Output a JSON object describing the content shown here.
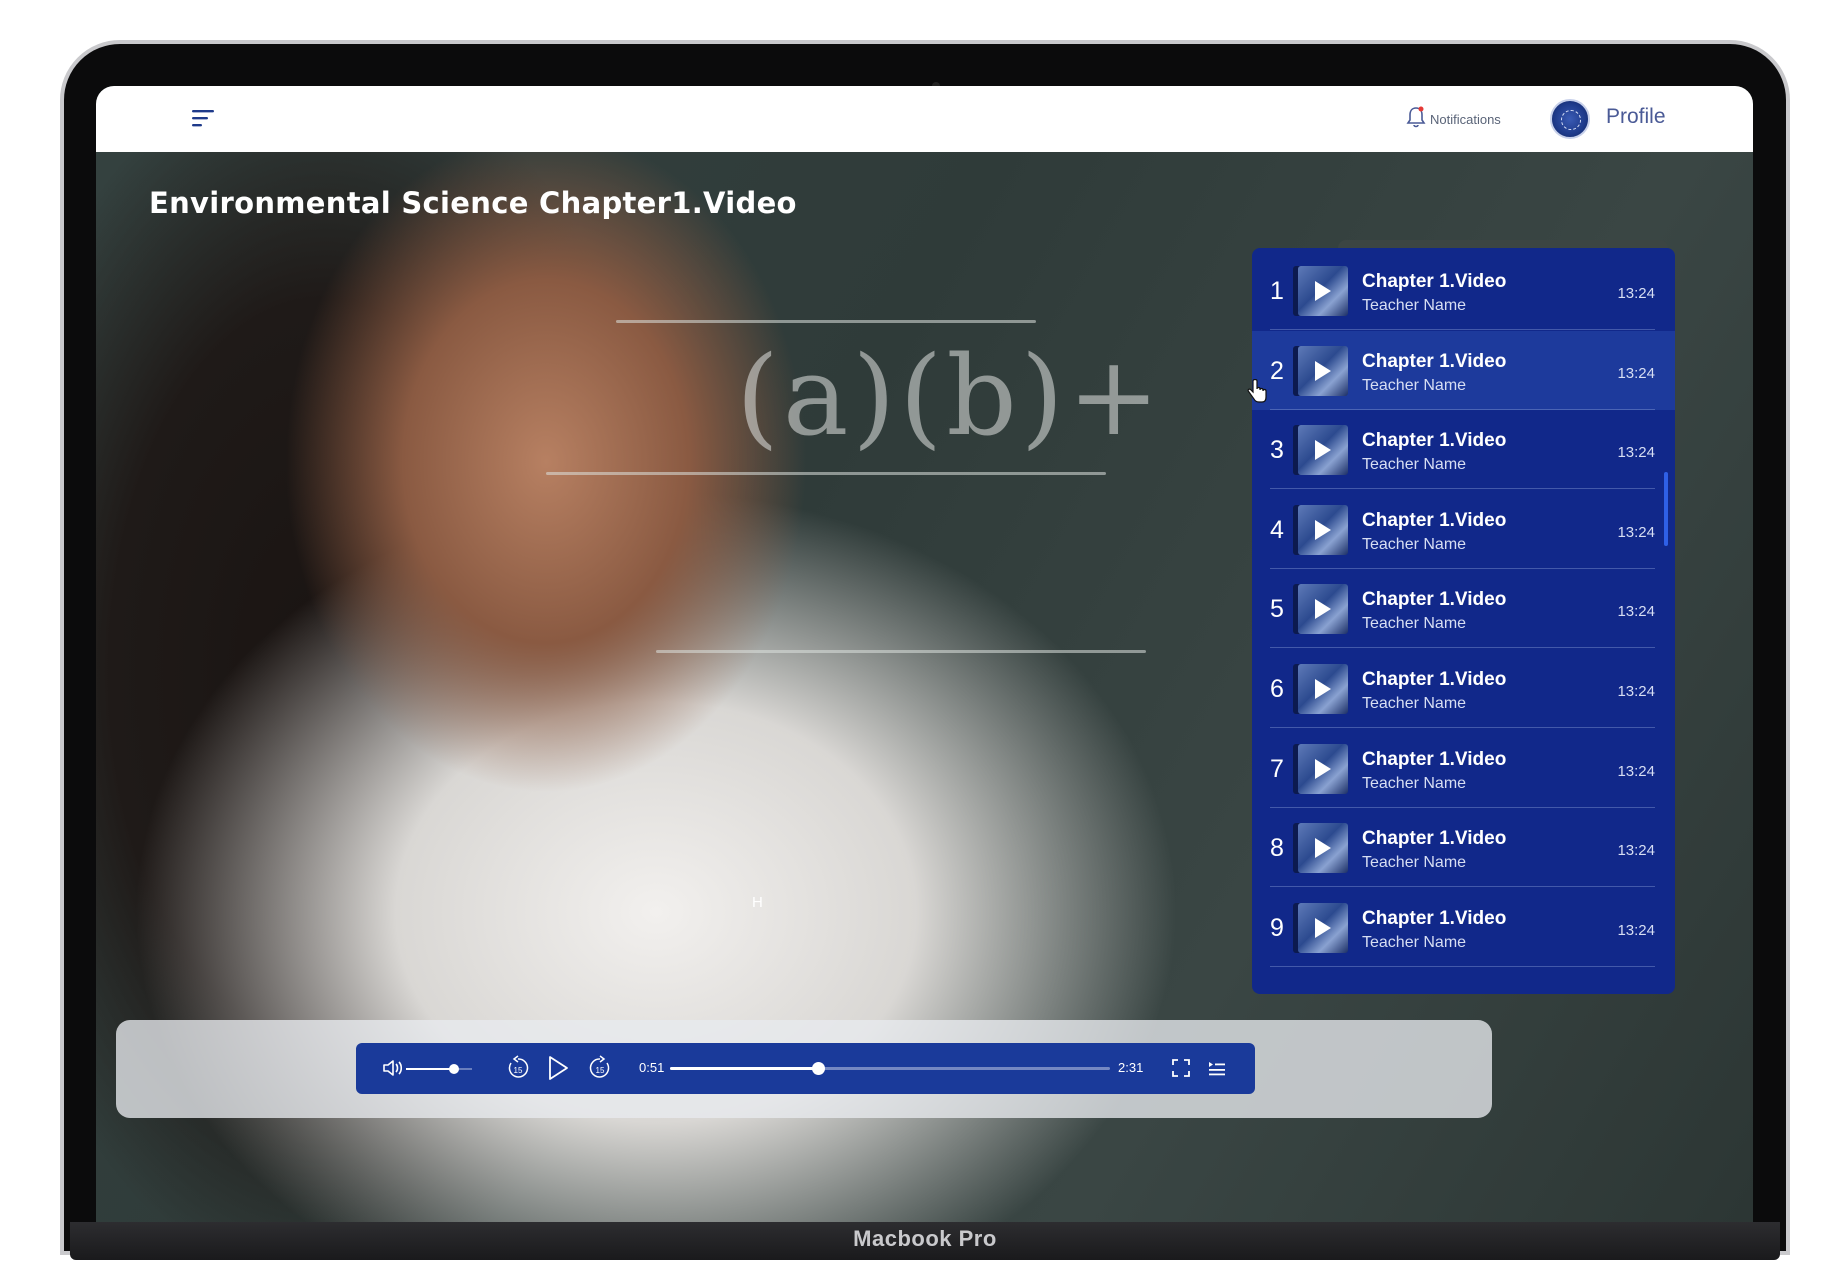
{
  "device_label": "Macbook Pro",
  "topbar": {
    "notifications_label": "Notifications",
    "profile_label": "Profile"
  },
  "video": {
    "title": "Environmental Science Chapter1.Video",
    "chalkboard_text": "(a)(b)+",
    "overlay_hint": "H"
  },
  "playlist": {
    "active_index": 2,
    "items": [
      {
        "number": "1",
        "title": "Chapter 1.Video",
        "teacher": "Teacher Name",
        "duration": "13:24"
      },
      {
        "number": "2",
        "title": "Chapter 1.Video",
        "teacher": "Teacher Name",
        "duration": "13:24"
      },
      {
        "number": "3",
        "title": "Chapter 1.Video",
        "teacher": "Teacher Name",
        "duration": "13:24"
      },
      {
        "number": "4",
        "title": "Chapter 1.Video",
        "teacher": "Teacher Name",
        "duration": "13:24"
      },
      {
        "number": "5",
        "title": "Chapter 1.Video",
        "teacher": "Teacher Name",
        "duration": "13:24"
      },
      {
        "number": "6",
        "title": "Chapter 1.Video",
        "teacher": "Teacher Name",
        "duration": "13:24"
      },
      {
        "number": "7",
        "title": "Chapter 1.Video",
        "teacher": "Teacher Name",
        "duration": "13:24"
      },
      {
        "number": "8",
        "title": "Chapter 1.Video",
        "teacher": "Teacher Name",
        "duration": "13:24"
      },
      {
        "number": "9",
        "title": "Chapter 1.Video",
        "teacher": "Teacher Name",
        "duration": "13:24"
      }
    ]
  },
  "player": {
    "current_time": "0:51",
    "total_time": "2:31",
    "progress_fraction": 0.337,
    "volume_fraction": 0.73,
    "skip_seconds_label": "15",
    "icons": [
      "volume-icon",
      "rewind-15-icon",
      "play-icon",
      "forward-15-icon",
      "fullscreen-icon",
      "playlist-icon"
    ]
  },
  "colors": {
    "brand_navy": "#11288a",
    "control_bar": "#1a3a9a",
    "active_row": "#1d3a9c",
    "nav_text": "#4a5a96"
  }
}
